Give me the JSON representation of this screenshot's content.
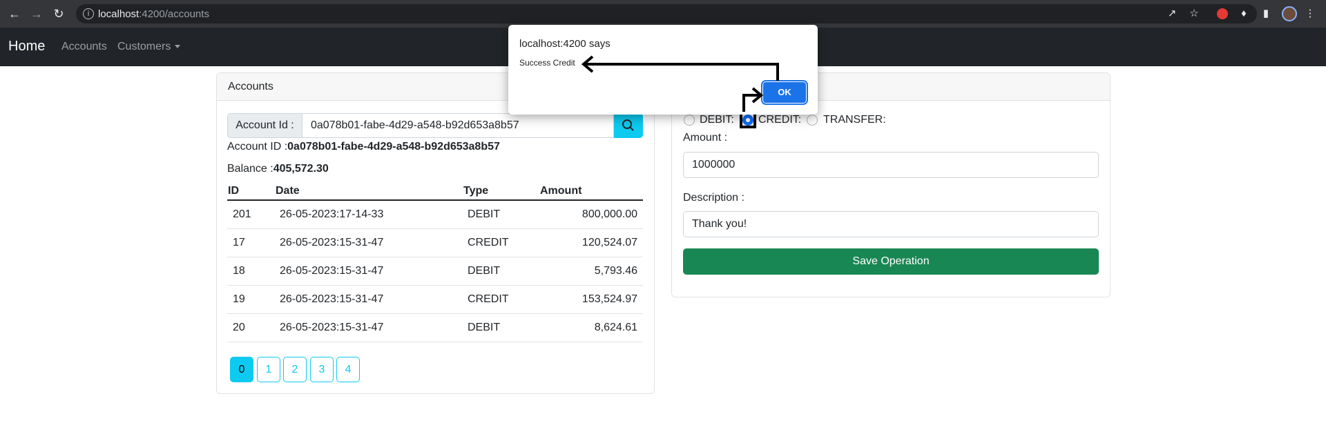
{
  "browser": {
    "url_host": "localhost",
    "url_path": ":4200/accounts"
  },
  "navbar": {
    "brand": "Home",
    "links": [
      "Accounts",
      "Customers"
    ]
  },
  "accounts_card": {
    "header": "Accounts",
    "search": {
      "label": "Account Id :",
      "value": "0a078b01-fabe-4d29-a548-b92d653a8b57"
    },
    "account_id_label": "Account ID :",
    "account_id_value": "0a078b01-fabe-4d29-a548-b92d653a8b57",
    "balance_label": "Balance :",
    "balance_value": "405,572.30",
    "table": {
      "headers": [
        "ID",
        "Date",
        "Type",
        "Amount"
      ],
      "rows": [
        {
          "id": "201",
          "date": "26-05-2023:17-14-33",
          "type": "DEBIT",
          "amount": "800,000.00"
        },
        {
          "id": "17",
          "date": "26-05-2023:15-31-47",
          "type": "CREDIT",
          "amount": "120,524.07"
        },
        {
          "id": "18",
          "date": "26-05-2023:15-31-47",
          "type": "DEBIT",
          "amount": "5,793.46"
        },
        {
          "id": "19",
          "date": "26-05-2023:15-31-47",
          "type": "CREDIT",
          "amount": "153,524.97"
        },
        {
          "id": "20",
          "date": "26-05-2023:15-31-47",
          "type": "DEBIT",
          "amount": "8,624.61"
        }
      ]
    },
    "pagination": [
      "0",
      "1",
      "2",
      "3",
      "4"
    ],
    "active_page": "0"
  },
  "operation_form": {
    "radios": [
      {
        "label": "DEBIT:",
        "checked": false
      },
      {
        "label": "CREDIT:",
        "checked": true
      },
      {
        "label": "TRANSFER:",
        "checked": false
      }
    ],
    "amount_label": "Amount :",
    "amount_value": "1000000",
    "description_label": "Description :",
    "description_value": "Thank you!",
    "save_label": "Save Operation"
  },
  "dialog": {
    "title": "localhost:4200 says",
    "message": "Success Credit",
    "ok_label": "OK"
  },
  "colors": {
    "accent": "#0dcaf0",
    "success": "#198754",
    "navbar": "#212529",
    "dialog_button": "#1a73e8"
  }
}
